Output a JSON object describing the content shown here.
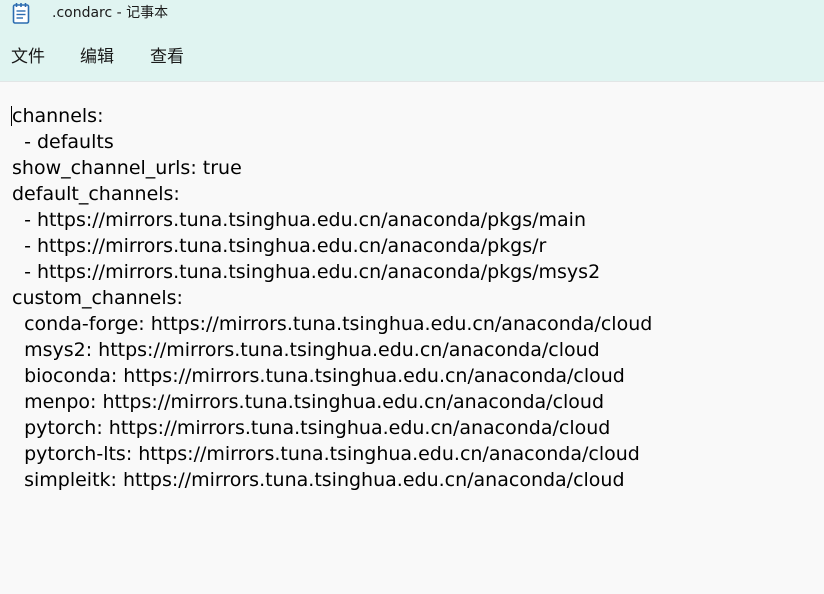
{
  "window": {
    "title": ".condarc - 记事本",
    "icon": "notepad-icon"
  },
  "menu": {
    "file_label": "文件",
    "edit_label": "编辑",
    "view_label": "查看"
  },
  "editor": {
    "content": "channels:\n  - defaults\nshow_channel_urls: true\ndefault_channels:\n  - https://mirrors.tuna.tsinghua.edu.cn/anaconda/pkgs/main\n  - https://mirrors.tuna.tsinghua.edu.cn/anaconda/pkgs/r\n  - https://mirrors.tuna.tsinghua.edu.cn/anaconda/pkgs/msys2\ncustom_channels:\n  conda-forge: https://mirrors.tuna.tsinghua.edu.cn/anaconda/cloud\n  msys2: https://mirrors.tuna.tsinghua.edu.cn/anaconda/cloud\n  bioconda: https://mirrors.tuna.tsinghua.edu.cn/anaconda/cloud\n  menpo: https://mirrors.tuna.tsinghua.edu.cn/anaconda/cloud\n  pytorch: https://mirrors.tuna.tsinghua.edu.cn/anaconda/cloud\n  pytorch-lts: https://mirrors.tuna.tsinghua.edu.cn/anaconda/cloud\n  simpleitk: https://mirrors.tuna.tsinghua.edu.cn/anaconda/cloud"
  },
  "colors": {
    "chrome_background": "#e0f4f1",
    "editor_background": "#f9f9f9",
    "icon_accent": "#2b6cb0"
  }
}
